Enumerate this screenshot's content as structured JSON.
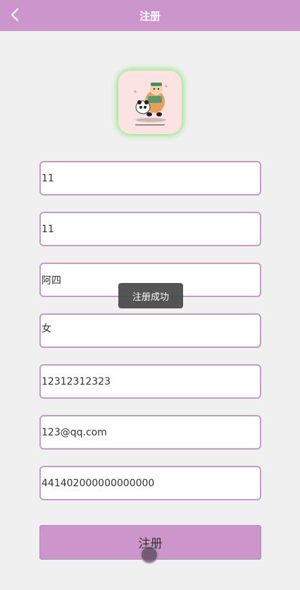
{
  "header": {
    "title": "注册",
    "back_icon": "chevron-left-icon"
  },
  "avatar": {
    "icon": "cartoon-avatar-icon"
  },
  "form": {
    "fields": [
      {
        "value": "11"
      },
      {
        "value": "11"
      },
      {
        "value": "阿四"
      },
      {
        "value": "女"
      },
      {
        "value": "12312312323"
      },
      {
        "value": "123@qq.com"
      },
      {
        "value": "441402000000000000"
      }
    ],
    "submit_label": "注册"
  },
  "toast": {
    "text": "注册成功"
  },
  "colors": {
    "accent": "#cc95cb",
    "border": "#c79ac8",
    "background": "#f1f0f1"
  }
}
